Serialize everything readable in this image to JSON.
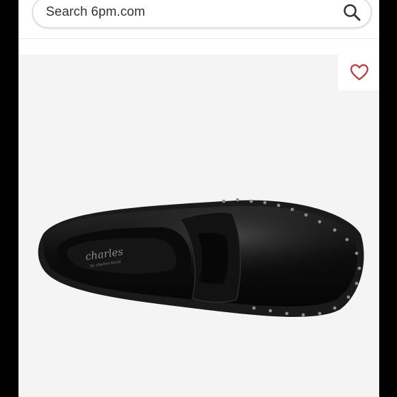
{
  "search": {
    "placeholder": "Search 6pm.com",
    "icon": "search-icon"
  },
  "product": {
    "image": "black-leather-penny-loafer-top-view",
    "brand_mark": "charles",
    "brand_sub": "by charles david",
    "favorite_icon": "heart-outline-icon"
  },
  "colors": {
    "accent_heart": "#b5464a",
    "panel_background": "#f4f4f4"
  }
}
